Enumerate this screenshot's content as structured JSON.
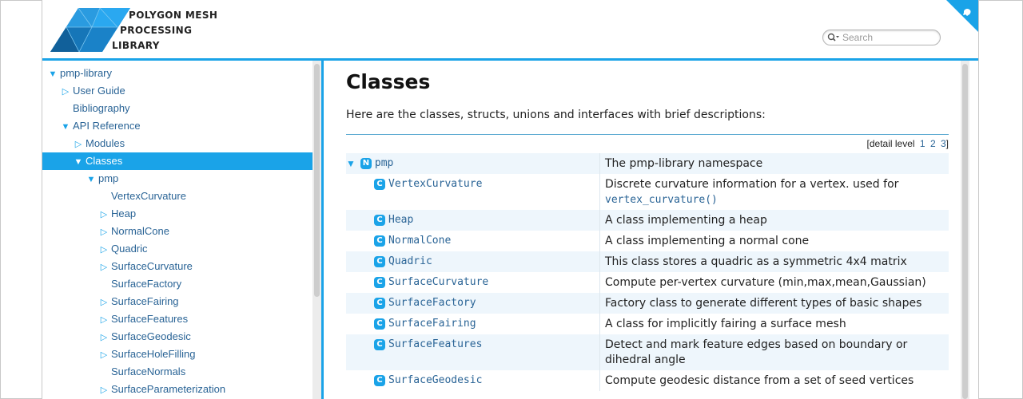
{
  "header": {
    "logo_lines": [
      "POLYGON MESH",
      "PROCESSING",
      "LIBRARY"
    ],
    "search_placeholder": "Search",
    "brand_color": "#1aa3e8"
  },
  "sidebar": {
    "items": [
      {
        "label": "pmp-library",
        "arrow": "▼",
        "depth": 0
      },
      {
        "label": "User Guide",
        "arrow": "▷",
        "depth": 1
      },
      {
        "label": "Bibliography",
        "arrow": "",
        "depth": 1
      },
      {
        "label": "API Reference",
        "arrow": "▼",
        "depth": 1
      },
      {
        "label": "Modules",
        "arrow": "▷",
        "depth": 2
      },
      {
        "label": "Classes",
        "arrow": "▼",
        "depth": 2,
        "selected": true
      },
      {
        "label": "pmp",
        "arrow": "▼",
        "depth": 3
      },
      {
        "label": "VertexCurvature",
        "arrow": "",
        "depth": 4
      },
      {
        "label": "Heap",
        "arrow": "▷",
        "depth": 4
      },
      {
        "label": "NormalCone",
        "arrow": "▷",
        "depth": 4
      },
      {
        "label": "Quadric",
        "arrow": "▷",
        "depth": 4
      },
      {
        "label": "SurfaceCurvature",
        "arrow": "▷",
        "depth": 4
      },
      {
        "label": "SurfaceFactory",
        "arrow": "",
        "depth": 4
      },
      {
        "label": "SurfaceFairing",
        "arrow": "▷",
        "depth": 4
      },
      {
        "label": "SurfaceFeatures",
        "arrow": "▷",
        "depth": 4
      },
      {
        "label": "SurfaceGeodesic",
        "arrow": "▷",
        "depth": 4
      },
      {
        "label": "SurfaceHoleFilling",
        "arrow": "▷",
        "depth": 4
      },
      {
        "label": "SurfaceNormals",
        "arrow": "",
        "depth": 4
      },
      {
        "label": "SurfaceParameterization",
        "arrow": "▷",
        "depth": 4
      }
    ]
  },
  "main": {
    "title": "Classes",
    "intro": "Here are the classes, structs, unions and interfaces with brief descriptions:",
    "detail_level": {
      "prefix": "[detail level",
      "levels": [
        "1",
        "2",
        "3"
      ],
      "suffix": "]"
    },
    "rows": [
      {
        "kind": "N",
        "name": "pmp",
        "expand": "▼",
        "indent": 0,
        "desc": "The pmp-library namespace",
        "code": ""
      },
      {
        "kind": "C",
        "name": "VertexCurvature",
        "expand": "",
        "indent": 1,
        "desc": "Discrete curvature information for a vertex. used for",
        "code": "vertex_curvature()"
      },
      {
        "kind": "C",
        "name": "Heap",
        "expand": "",
        "indent": 1,
        "desc": "A class implementing a heap",
        "code": ""
      },
      {
        "kind": "C",
        "name": "NormalCone",
        "expand": "",
        "indent": 1,
        "desc": "A class implementing a normal cone",
        "code": ""
      },
      {
        "kind": "C",
        "name": "Quadric",
        "expand": "",
        "indent": 1,
        "desc": "This class stores a quadric as a symmetric 4x4 matrix",
        "code": ""
      },
      {
        "kind": "C",
        "name": "SurfaceCurvature",
        "expand": "",
        "indent": 1,
        "desc": "Compute per-vertex curvature (min,max,mean,Gaussian)",
        "code": ""
      },
      {
        "kind": "C",
        "name": "SurfaceFactory",
        "expand": "",
        "indent": 1,
        "desc": "Factory class to generate different types of basic shapes",
        "code": ""
      },
      {
        "kind": "C",
        "name": "SurfaceFairing",
        "expand": "",
        "indent": 1,
        "desc": "A class for implicitly fairing a surface mesh",
        "code": ""
      },
      {
        "kind": "C",
        "name": "SurfaceFeatures",
        "expand": "",
        "indent": 1,
        "desc": "Detect and mark feature edges based on boundary or dihedral angle",
        "code": ""
      },
      {
        "kind": "C",
        "name": "SurfaceGeodesic",
        "expand": "",
        "indent": 1,
        "desc": "Compute geodesic distance from a set of seed vertices",
        "code": ""
      }
    ]
  }
}
